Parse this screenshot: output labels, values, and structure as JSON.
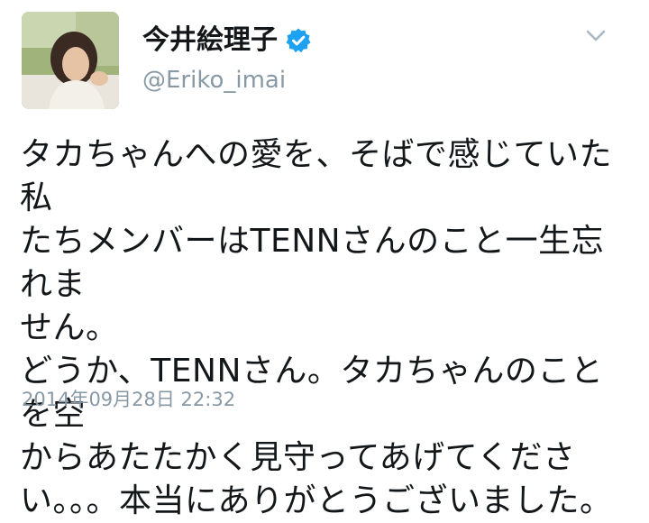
{
  "tweet": {
    "display_name": "今井絵理子",
    "handle": "@Eriko_imai",
    "verified": true,
    "text": "タカちゃんへの愛を、そばで感じていた私\nたちメンバーはTENNさんのこと一生忘れま\nせん。\nどうか、TENNさん。タカちゃんのことを空\nからあたたかく見守ってあげてくださ\nい。。。本当にありがとうございました。",
    "timestamp": "2014年09月28日 22:32"
  },
  "icons": {
    "verified": "verified-badge-icon",
    "menu": "chevron-down-icon"
  },
  "colors": {
    "verified_blue": "#1da1f2",
    "text_primary": "#14171a",
    "text_secondary": "#8899a6"
  }
}
